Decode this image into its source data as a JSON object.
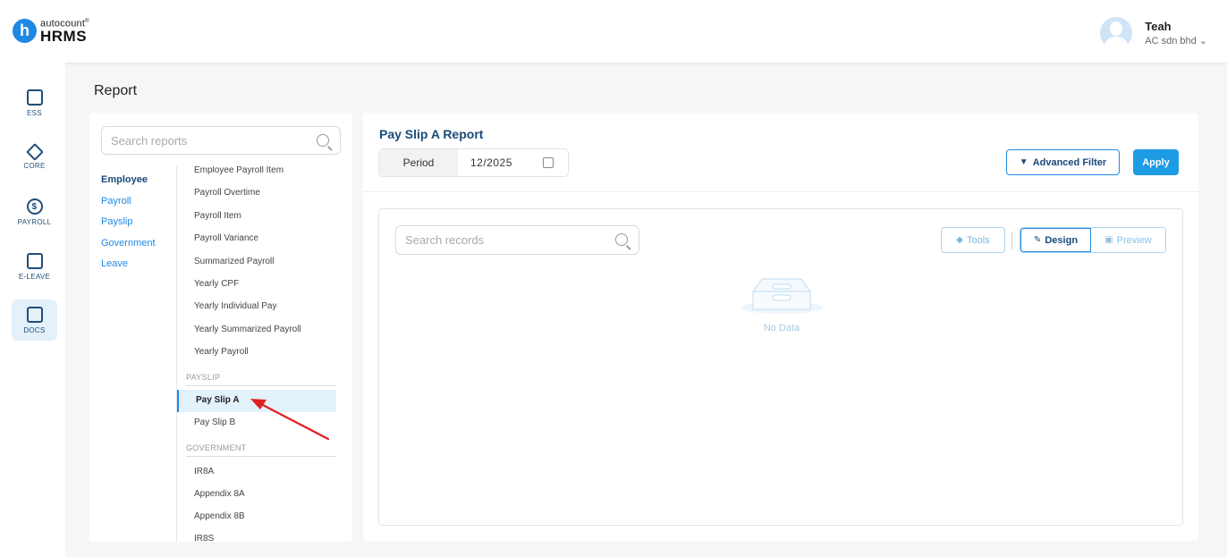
{
  "app": {
    "logo_letter": "h",
    "logo_top": "autocount",
    "logo_reg": "®",
    "logo_bottom": "HRMS"
  },
  "user": {
    "name": "Teah",
    "company": "AC sdn bhd ⌄"
  },
  "rail": [
    {
      "label": "ESS",
      "icon": "user-card-icon"
    },
    {
      "label": "CORE",
      "icon": "cube-icon"
    },
    {
      "label": "PAYROLL",
      "icon": "dollar-icon"
    },
    {
      "label": "E-LEAVE",
      "icon": "calendar-icon"
    },
    {
      "label": "DOCS",
      "icon": "document-chart-icon"
    }
  ],
  "page_title": "Report",
  "search_reports_placeholder": "Search reports",
  "categories": [
    "Employee",
    "Payroll",
    "Payslip",
    "Government",
    "Leave"
  ],
  "reports": {
    "partial_top": "Employee Payroll Item",
    "payroll_items": [
      "Payroll Overtime",
      "Payroll Item",
      "Payroll Variance",
      "Summarized Payroll",
      "Yearly CPF",
      "Yearly Individual Pay",
      "Yearly Summarized Payroll",
      "Yearly Payroll"
    ],
    "payslip_header": "PAYSLIP",
    "payslip_selected": "Pay Slip A",
    "payslip_other": "Pay Slip B",
    "government_header": "GOVERNMENT",
    "government_items": [
      "IR8A",
      "Appendix 8A",
      "Appendix 8B",
      "IR8S"
    ]
  },
  "main": {
    "title": "Pay Slip A Report",
    "period_label": "Period",
    "period_value": "12/2025",
    "advanced_filter": "Advanced Filter",
    "apply": "Apply",
    "search_records_placeholder": "Search records",
    "tools": "Tools",
    "design": "Design",
    "preview": "Preview",
    "empty_text": "No Data"
  },
  "colors": {
    "accent": "#1e88e5",
    "navy": "#1a4a7a",
    "arrow": "#e02020"
  }
}
